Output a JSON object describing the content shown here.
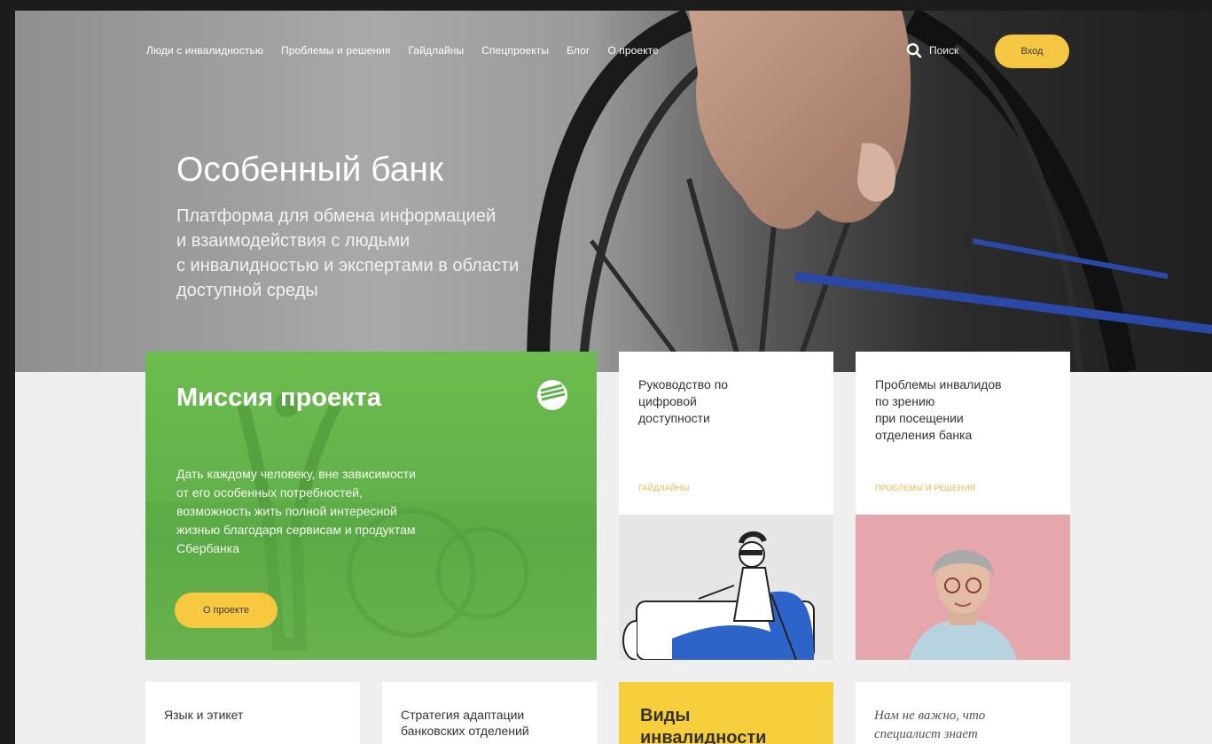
{
  "nav": {
    "items": [
      "Люди с инвалидностью",
      "Проблемы и решения",
      "Гайдлайны",
      "Спецпроекты",
      "Блог",
      "О проекте"
    ],
    "search_label": "Поиск",
    "search_icon": "search-icon",
    "login_label": "Вход"
  },
  "hero": {
    "title": "Особенный банк",
    "subtitle": "Платформа для обмена информацией\nи взаимодействия с людьми\nс инвалидностью и экспертами в области\nдоступной среды"
  },
  "mission": {
    "title": "Миссия проекта",
    "text": "Дать каждому человеку, вне зависимости\nот его особенных потребностей,\nвозможность жить полной интересной\nжизнью благодаря сервисам и продуктам\nСбербанка",
    "button_label": "О проекте"
  },
  "cards": [
    {
      "title": "Руководство по\nцифровой\nдоступности",
      "tag": "ГАЙДЛАЙНЫ"
    },
    {
      "title": "Проблемы инвалидов\nпо зрению\nпри посещении\nотделения банка",
      "tag": "ПРОБЛЕМЫ И РЕШЕНИЯ"
    }
  ],
  "bottom_cards": [
    {
      "title": "Язык и этикет"
    },
    {
      "title": "Стратегия адаптации\nбанковских отделений"
    },
    {
      "title": "Виды\nинвалидности"
    },
    {
      "title": "Нам не важно, что\nспециалист знает"
    }
  ],
  "colors": {
    "accent_yellow": "#f7c840",
    "mission_green": "#62b14b",
    "tag_orange": "#f0b44a"
  }
}
